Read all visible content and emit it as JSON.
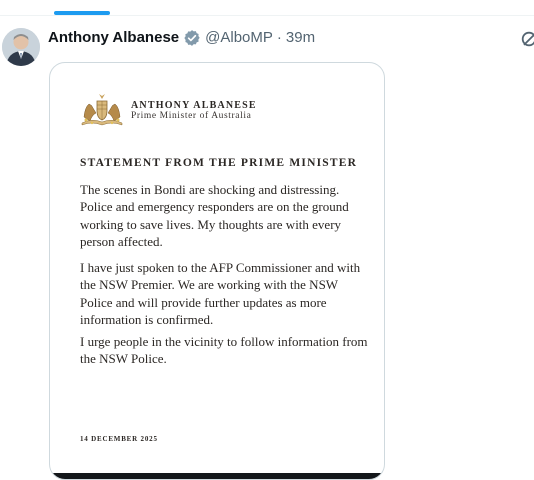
{
  "colors": {
    "accent": "#1d9bf0",
    "verified": "#829aab"
  },
  "tweet": {
    "author_name": "Anthony Albanese",
    "author_handle": "@AlboMP",
    "separator": "·",
    "timestamp": "39m",
    "avatar_icon": "user-avatar",
    "verified_icon": "verified-badge-icon",
    "overflow_icon": "grok-icon"
  },
  "statement": {
    "crest_icon": "australian-coat-of-arms",
    "letterhead_name": "ANTHONY ALBANESE",
    "letterhead_title": "Prime Minister of Australia",
    "heading": "STATEMENT FROM THE PRIME MINISTER",
    "paragraphs": [
      "The scenes in Bondi are shocking and distressing. Police and emergency responders are on the ground working to save lives. My thoughts are with every person affected.",
      "I have just spoken to the AFP Commissioner and with the NSW Premier. We are working with the NSW Police and will provide further updates as more information is confirmed.",
      "I urge people in the vicinity to follow information from the NSW Police."
    ],
    "date": "14 DECEMBER 2025"
  }
}
